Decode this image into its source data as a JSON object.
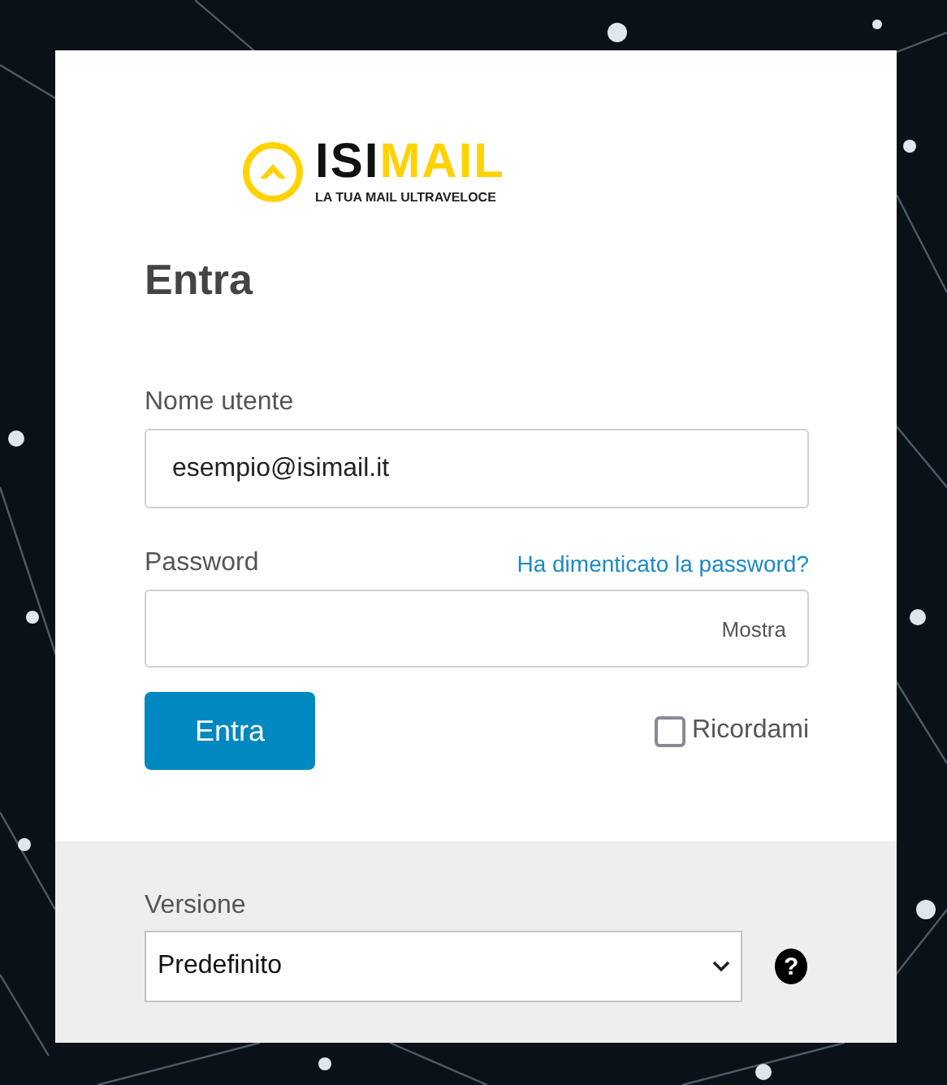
{
  "logo": {
    "name_dark": "ISI",
    "name_accent": "MAIL",
    "tagline": "LA TUA MAIL ULTRAVELOCE"
  },
  "heading": "Entra",
  "username": {
    "label": "Nome utente",
    "value": "esempio@isimail.it"
  },
  "password": {
    "label": "Password",
    "forgot_link": "Ha dimenticato la password?",
    "show_toggle": "Mostra"
  },
  "submit_button": "Entra",
  "remember": {
    "label": "Ricordami",
    "checked": false
  },
  "version": {
    "label": "Versione",
    "value": "Predefinito",
    "help": "?"
  }
}
